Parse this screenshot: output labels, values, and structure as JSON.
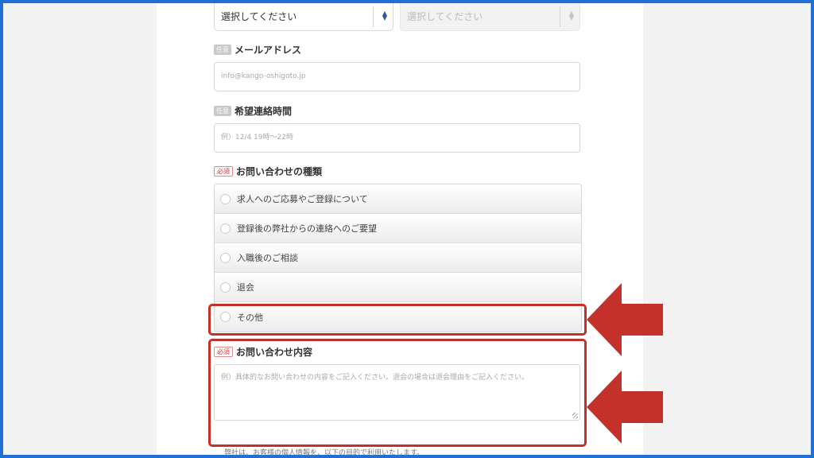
{
  "selects": {
    "first_value": "選択してください",
    "second_value": "選択してください"
  },
  "email": {
    "badge": "任意",
    "label": "メールアドレス",
    "placeholder": "info@kango-oshigoto.jp"
  },
  "contact_time": {
    "badge": "任意",
    "label": "希望連絡時間",
    "placeholder": "例）12/4 19時〜22時"
  },
  "inquiry_type": {
    "badge": "必須",
    "label": "お問い合わせの種類",
    "options": [
      "求人へのご応募やご登録について",
      "登録後の弊社からの連絡へのご要望",
      "入職後のご相談",
      "退会",
      "その他"
    ]
  },
  "inquiry_content": {
    "badge": "必須",
    "label": "お問い合わせ内容",
    "placeholder": "例）具体的なお問い合わせの内容をご記入ください。退会の場合は退会理由をご記入ください。"
  },
  "privacy_text": "弊社は、お客様の個人情報を、以下の目的で利用いたします。",
  "colors": {
    "frame": "#1f6fd6",
    "highlight": "#c3312a",
    "required": "#dd3333"
  }
}
